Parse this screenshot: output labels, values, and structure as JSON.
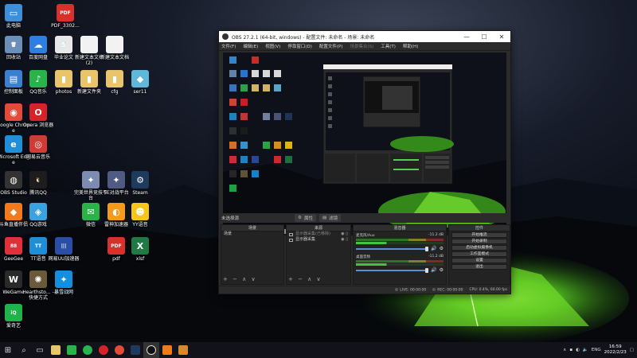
{
  "desktop": {
    "icons": [
      {
        "label": "此电脑",
        "glyph": "▭",
        "color": "#3d8fd9"
      },
      {
        "label": "PDF_3302...",
        "glyph": "PDF",
        "color": "#d9302c"
      },
      {
        "label": "回收站",
        "glyph": "🗑",
        "color": "#6c8fb8"
      },
      {
        "label": "百度网盘",
        "glyph": "☁",
        "color": "#2f7fe0"
      },
      {
        "label": "毕业论文",
        "glyph": "📄",
        "color": "#e8e8e8"
      },
      {
        "label": "新建文本文档(2)",
        "glyph": "",
        "color": "#f2f2f2"
      },
      {
        "label": "新建文本文档",
        "glyph": "",
        "color": "#f2f2f2"
      },
      {
        "label": "控制面板",
        "glyph": "▤",
        "color": "#3a7fd0"
      },
      {
        "label": "QQ音乐",
        "glyph": "♪",
        "color": "#29b34a"
      },
      {
        "label": "photos",
        "glyph": "▮",
        "color": "#e8c56a"
      },
      {
        "label": "新建文件夹",
        "glyph": "▮",
        "color": "#e8c56a"
      },
      {
        "label": "cfg",
        "glyph": "▮",
        "color": "#e8c56a"
      },
      {
        "label": "ser11",
        "glyph": "◆",
        "color": "#5fb7d9"
      },
      {
        "label": "Google Chrome",
        "glyph": "◉",
        "color": "#e24a3a"
      },
      {
        "label": "Opera 浏览器",
        "glyph": "O",
        "color": "#d6232a"
      },
      {
        "label": "Microsoft Edge",
        "glyph": "e",
        "color": "#1f8fd8"
      },
      {
        "label": "网易云音乐",
        "glyph": "◎",
        "color": "#d23a36"
      },
      {
        "label": "完美世界竞技平台",
        "glyph": "✦",
        "color": "#7c8bb0"
      },
      {
        "label": "5E对战平台",
        "glyph": "✦",
        "color": "#4f5b82"
      },
      {
        "label": "Steam",
        "glyph": "⚙",
        "color": "#1e3a5c"
      },
      {
        "label": "OBS Studio",
        "glyph": "◍",
        "color": "#333"
      },
      {
        "label": "腾讯QQ",
        "glyph": "🐧",
        "color": "#1d1d1d"
      },
      {
        "label": "斗鱼直播伴侣",
        "glyph": "◆",
        "color": "#f07a1e"
      },
      {
        "label": "QQ游戏",
        "glyph": "◈",
        "color": "#3aa2e0"
      },
      {
        "label": "微信",
        "glyph": "✉",
        "color": "#2bb34a"
      },
      {
        "label": "雷神加速器",
        "glyph": "◐",
        "color": "#f39a1d"
      },
      {
        "label": "YY语音",
        "glyph": "☻",
        "color": "#f5c51a"
      },
      {
        "label": "GeeGee",
        "glyph": "88",
        "color": "#e0303a"
      },
      {
        "label": "TT语音",
        "glyph": "TT",
        "color": "#1f8ed8"
      },
      {
        "label": "网易UU加速器",
        "glyph": "|||",
        "color": "#2a4ea5"
      },
      {
        "label": "pdf",
        "glyph": "PDF",
        "color": "#d9302c"
      },
      {
        "label": "xlsf",
        "glyph": "X",
        "color": "#1f7a44"
      },
      {
        "label": "WeGame",
        "glyph": "W",
        "color": "#2a2a2a"
      },
      {
        "label": "Hearthsto... - 快捷方式",
        "glyph": "✺",
        "color": "#6a5a3a"
      },
      {
        "label": "暴雪战网",
        "glyph": "✦",
        "color": "#148fe0"
      },
      {
        "label": "爱奇艺",
        "glyph": "iQ",
        "color": "#1fb34a"
      }
    ]
  },
  "obs": {
    "title": "OBS 27.2.1 (64-bit, windows) - 配置文件: 未命名 - 场景: 未命名",
    "title_buttons": [
      "—",
      "☐",
      "✕"
    ],
    "menu": [
      "文件(F)",
      "编辑(E)",
      "视图(V)",
      "停靠窗口(D)",
      "配置文件(P)",
      "场景集合(S)",
      "工具(T)",
      "帮助(H)"
    ],
    "menu_dim_index": 5,
    "scene_state_label": "未选择源",
    "properties_label": "属性",
    "filters_label": "滤镜",
    "docks": {
      "scenes": {
        "title": "场景",
        "items": [
          "场景"
        ]
      },
      "sources": {
        "title": "来源",
        "items": [
          "显示器采集(已移除)",
          "显示器采集"
        ]
      },
      "mixer": {
        "title": "混音器",
        "channels": [
          {
            "name": "麦克风/Aux",
            "db": "-11.2 dB"
          },
          {
            "name": "桌面音频",
            "db": "-11.2 dB"
          }
        ]
      },
      "controls": {
        "title": "控件",
        "buttons": [
          "开始推流",
          "开始录制",
          "启动虚拟摄像机",
          "工作室模式",
          "设置",
          "退出"
        ]
      }
    },
    "dock_footer_symbols": "+ − ∧ ∨",
    "status": {
      "live": "LIVE: 00:00:00",
      "rec": "REC: 00:00:00",
      "cpu": "CPU: 0.4%, 60.00 fps"
    }
  },
  "taskbar": {
    "start_icon": "windows-start",
    "pinned": [
      "search",
      "task-view",
      "file-explorer",
      "wechat",
      "qq-music",
      "opera",
      "chrome",
      "steam",
      "obs",
      "douyu",
      "calendar"
    ],
    "tray_text": "ENG",
    "time": "16:59",
    "date": "2022/2/23"
  }
}
